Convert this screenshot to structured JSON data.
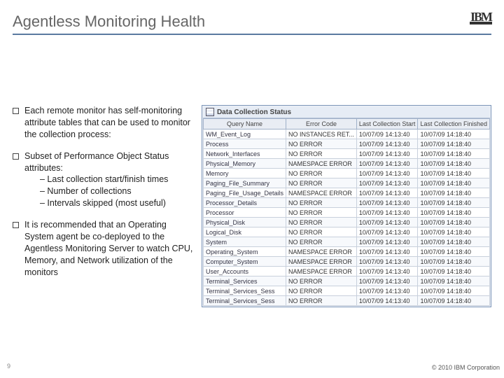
{
  "title": "Agentless Monitoring Health",
  "logo": {
    "text": "IBM"
  },
  "bullets": [
    "Each remote monitor has self-monitoring attribute tables that can be used to monitor the collection process:",
    "Subset of Performance Object Status attributes:",
    "It is recommended that an Operating System agent be co-deployed to the Agentless Monitoring Server to watch CPU, Memory, and Network utilization of the monitors"
  ],
  "subs": [
    "– Last collection start/finish times",
    "– Number of collections",
    "– Intervals skipped (most useful)"
  ],
  "panel": {
    "title": "Data Collection Status"
  },
  "table": {
    "headers": [
      "Query Name",
      "Error Code",
      "Last Collection Start",
      "Last Collection Finished"
    ],
    "rows": [
      [
        "WM_Event_Log",
        "NO INSTANCES RET...",
        "10/07/09 14:13:40",
        "10/07/09 14:18:40"
      ],
      [
        "Process",
        "NO ERROR",
        "10/07/09 14:13:40",
        "10/07/09 14:18:40"
      ],
      [
        "Network_Interfaces",
        "NO ERROR",
        "10/07/09 14:13:40",
        "10/07/09 14:18:40"
      ],
      [
        "Physical_Memory",
        "NAMESPACE ERROR",
        "10/07/09 14:13:40",
        "10/07/09 14:18:40"
      ],
      [
        "Memory",
        "NO ERROR",
        "10/07/09 14:13:40",
        "10/07/09 14:18:40"
      ],
      [
        "Paging_File_Summary",
        "NO ERROR",
        "10/07/09 14:13:40",
        "10/07/09 14:18:40"
      ],
      [
        "Paging_File_Usage_Details",
        "NAMESPACE ERROR",
        "10/07/09 14:13:40",
        "10/07/09 14:18:40"
      ],
      [
        "Processor_Details",
        "NO ERROR",
        "10/07/09 14:13:40",
        "10/07/09 14:18:40"
      ],
      [
        "Processor",
        "NO ERROR",
        "10/07/09 14:13:40",
        "10/07/09 14:18:40"
      ],
      [
        "Physical_Disk",
        "NO ERROR",
        "10/07/09 14:13:40",
        "10/07/09 14:18:40"
      ],
      [
        "Logical_Disk",
        "NO ERROR",
        "10/07/09 14:13:40",
        "10/07/09 14:18:40"
      ],
      [
        "System",
        "NO ERROR",
        "10/07/09 14:13:40",
        "10/07/09 14:18:40"
      ],
      [
        "Operating_System",
        "NAMESPACE ERROR",
        "10/07/09 14:13:40",
        "10/07/09 14:18:40"
      ],
      [
        "Computer_System",
        "NAMESPACE ERROR",
        "10/07/09 14:13:40",
        "10/07/09 14:18:40"
      ],
      [
        "User_Accounts",
        "NAMESPACE ERROR",
        "10/07/09 14:13:40",
        "10/07/09 14:18:40"
      ],
      [
        "Terminal_Services",
        "NO ERROR",
        "10/07/09 14:13:40",
        "10/07/09 14:18:40"
      ],
      [
        "Terminal_Services_Sess",
        "NO ERROR",
        "10/07/09 14:13:40",
        "10/07/09 14:18:40"
      ],
      [
        "Terminal_Services_Sess",
        "NO ERROR",
        "10/07/09 14:13:40",
        "10/07/09 14:18:40"
      ]
    ]
  },
  "pagenum": "9",
  "copyright": "© 2010 IBM Corporation"
}
